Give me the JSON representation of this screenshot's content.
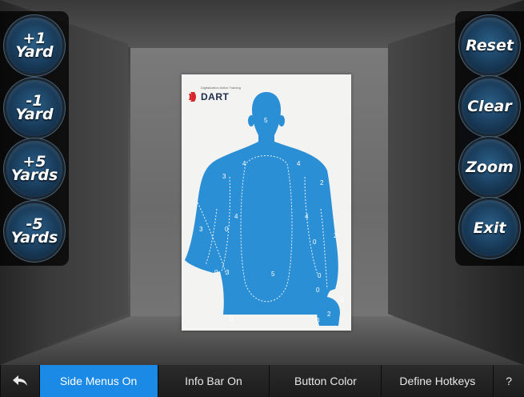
{
  "left_menu": [
    {
      "label": "+1\nYard"
    },
    {
      "label": "-1\nYard"
    },
    {
      "label": "+5\nYards"
    },
    {
      "label": "-5\nYards"
    }
  ],
  "right_menu": [
    {
      "label": "Reset"
    },
    {
      "label": "Clear"
    },
    {
      "label": "Zoom"
    },
    {
      "label": "Exit"
    }
  ],
  "target": {
    "brand": "DART",
    "brand_sub": "Digitalization Active Training",
    "colors": {
      "silhouette": "#2b8fd6",
      "paper": "#f3f3f1",
      "logo_red": "#d8262c"
    },
    "score_labels": [
      "5",
      "4",
      "4",
      "3",
      "2",
      "4",
      "4",
      "3",
      "0",
      "0",
      "2",
      "5",
      "0",
      "3",
      "0",
      "0",
      "2",
      "0",
      "0",
      "0"
    ]
  },
  "bottom_bar": {
    "back_icon": "back-arrow-icon",
    "items": [
      {
        "label": "Side Menus On",
        "active": true
      },
      {
        "label": "Info Bar On",
        "active": false
      },
      {
        "label": "Button Color",
        "active": false
      },
      {
        "label": "Define Hotkeys",
        "active": false
      },
      {
        "label": "?",
        "active": false
      }
    ],
    "active_color": "#1b8ae6"
  }
}
